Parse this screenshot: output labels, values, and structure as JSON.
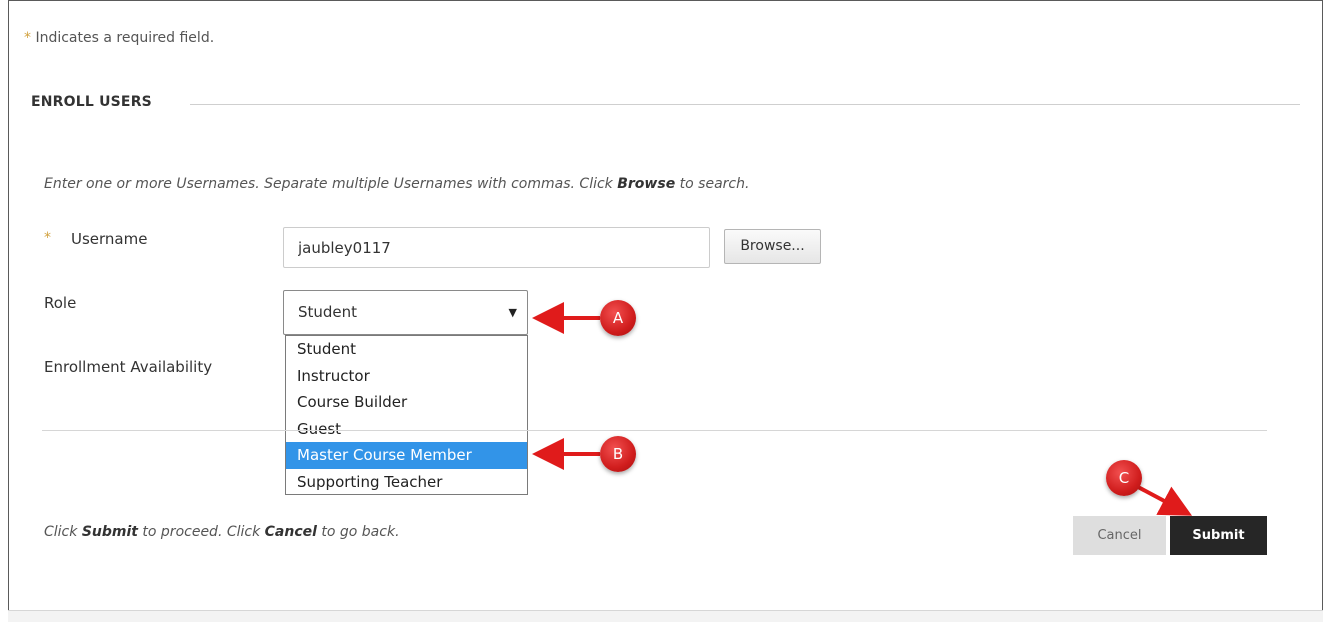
{
  "form": {
    "required_star": "*",
    "required_note": "Indicates a required field.",
    "section_title": "ENROLL USERS",
    "instructions_pre": "Enter one or more Usernames. Separate multiple Usernames with commas. Click ",
    "instructions_bold": "Browse",
    "instructions_post": " to search.",
    "username_label": "Username",
    "username_value": "jaubley0117",
    "browse_label": "Browse...",
    "role_label": "Role",
    "role_selected": "Student",
    "role_options": [
      "Student",
      "Instructor",
      "Course Builder",
      "Guest",
      "Master Course Member",
      "Supporting Teacher"
    ],
    "enrollment_availability_label": "Enrollment Availability",
    "footer_pre": "Click ",
    "footer_submit": "Submit",
    "footer_mid": " to proceed. Click ",
    "footer_cancel": "Cancel",
    "footer_post": " to go back.",
    "cancel_label": "Cancel",
    "submit_label": "Submit"
  },
  "callouts": {
    "a": "A",
    "b": "B",
    "c": "C"
  },
  "colors": {
    "required": "#d1a13e",
    "highlight": "#3294e8",
    "submit_bg": "#262626",
    "callout": "#d01d1d"
  }
}
